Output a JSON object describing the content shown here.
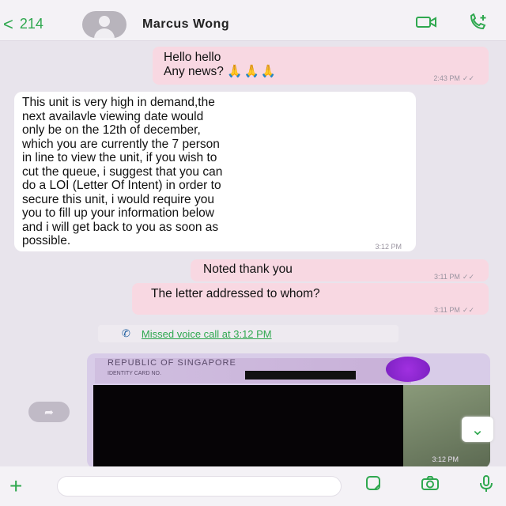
{
  "header": {
    "back_count": "214",
    "contact_name": "Marcus Wong",
    "icons": [
      "video-call-icon",
      "voice-call-icon"
    ]
  },
  "messages": [
    {
      "direction": "outgoing",
      "line1": "Hello hello",
      "line2": "Any news?",
      "emoji": "🙏🙏🙏",
      "time": "2:43 PM"
    },
    {
      "direction": "incoming",
      "lines": [
        "This unit is very high in demand,the",
        "next availavle viewing date would",
        "only be on the 12th of december,",
        "which you are currently the 7 person",
        "in line to view the unit, if you wish to",
        "cut the queue, i suggest that you can",
        "do a LOI (Letter Of Intent) in order to",
        "secure this unit, i would require you",
        "you to fill up your information below",
        "and i will get back to you as soon as",
        "possible."
      ],
      "time": "3:12 PM"
    },
    {
      "direction": "outgoing",
      "text": "Noted thank you",
      "time": "3:11 PM"
    },
    {
      "direction": "outgoing",
      "text": "The letter addressed to whom?",
      "time": "3:11 PM"
    }
  ],
  "missed_call": {
    "text": "Missed voice call at 3:12 PM"
  },
  "photo": {
    "country": "REPUBLIC OF SINGAPORE",
    "field": "IDENTITY CARD NO.",
    "time": "3:12 PM"
  },
  "compose": {
    "placeholder": ""
  },
  "colors": {
    "accent": "#2fa84f",
    "outgoing_bubble": "#f8d8e2",
    "incoming_bubble": "#ffffff"
  }
}
